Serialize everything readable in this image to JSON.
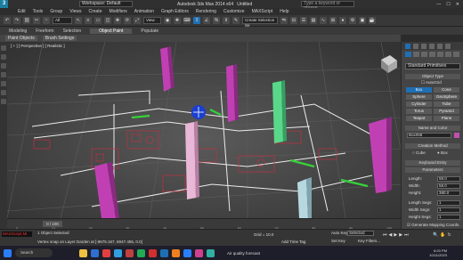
{
  "title_bar": {
    "workspace": "Workspace: Default",
    "file_name": "Autodesk 3ds Max 2014 x64",
    "doc_title": "Untitled",
    "search_placeholder": "Type a keyword or phrase"
  },
  "menu": [
    "Edit",
    "Tools",
    "Group",
    "Views",
    "Create",
    "Modifiers",
    "Animation",
    "Graph Editors",
    "Rendering",
    "Customize",
    "MAXScript",
    "Help"
  ],
  "toolbar": {
    "selection_filter": "All",
    "ref_coord": "View",
    "selection_set": "Create Selection Se"
  },
  "ribbon": {
    "tabs": [
      "Modeling",
      "Freeform",
      "Selection",
      "Object Paint",
      "Populate"
    ],
    "active_tab": "Object Paint",
    "subtabs": [
      "Paint Objects",
      "Brush Settings"
    ]
  },
  "viewport": {
    "label": "[ + ] [ Perspective ] [ Realistic ]"
  },
  "command_panel": {
    "category": "Standard Primitives",
    "object_type_title": "Object Type",
    "autogrid": "AutoGrid",
    "primitives": [
      "Box",
      "Cone",
      "Sphere",
      "GeoSphere",
      "Cylinder",
      "Tube",
      "Torus",
      "Pyramid",
      "Teapot",
      "Plane"
    ],
    "active_primitive": "Box",
    "name_color_title": "Name and Color",
    "name_value": "Box058",
    "swatch_color": "#c050b0",
    "creation_method_title": "Creation Method",
    "creation_options": [
      "Cube",
      "Box"
    ],
    "keyboard_entry": "Keyboard Entry",
    "parameters_title": "Parameters",
    "params": [
      {
        "label": "Length:",
        "value": "58.0"
      },
      {
        "label": "Width:",
        "value": "58.0"
      },
      {
        "label": "Height:",
        "value": "380.0"
      },
      {
        "label": "Length Segs:",
        "value": "1"
      },
      {
        "label": "Width Segs:",
        "value": "1"
      },
      {
        "label": "Height Segs:",
        "value": "1"
      }
    ],
    "gen_mapping": "Generate Mapping Coords."
  },
  "timeline": {
    "frame": "0 / 100",
    "ticks": [
      "0",
      "10",
      "20",
      "30",
      "40",
      "50",
      "60",
      "70",
      "80",
      "90",
      "100"
    ]
  },
  "status": {
    "script_label": "MAXScript Mi",
    "selection_text": "1 Object Selected",
    "prompt_text": "Vertex snap on Layer:Garden at [-8675.167, 6947.455, 0.0]",
    "grid": "Grid = 10.0",
    "auto_key": "Auto Key",
    "selected": "Selected",
    "set_key": "Set Key",
    "key_filters": "Key Filters...",
    "add_time_tag": "Add Time Tag"
  },
  "taskbar": {
    "search": "Search",
    "weather": "Air quality forecast",
    "time": "6:20 PM",
    "date": "10/11/2023",
    "icon_colors": [
      "#f0c040",
      "#2f6fd0",
      "#e24040",
      "#30a0e0",
      "#c04040",
      "#22aa55",
      "#d03030",
      "#1f6fb5",
      "#f08020",
      "#2a7fff",
      "#d04090",
      "#30b0a0"
    ]
  }
}
